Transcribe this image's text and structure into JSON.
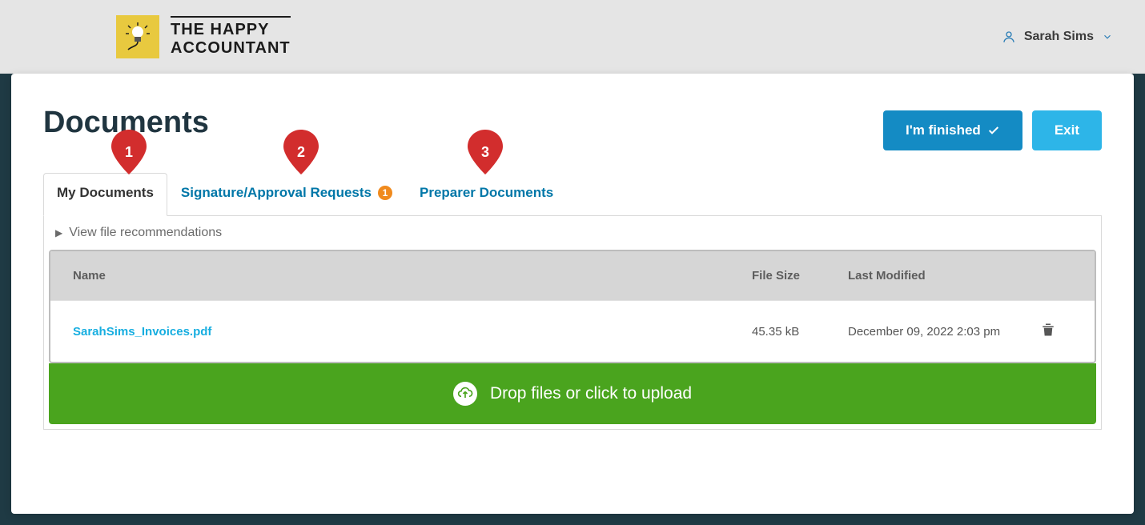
{
  "brand": {
    "line1": "THE HAPPY",
    "line2": "ACCOUNTANT"
  },
  "user": {
    "name": "Sarah Sims"
  },
  "page": {
    "title": "Documents"
  },
  "buttons": {
    "finished": "I'm finished",
    "exit": "Exit"
  },
  "tabs": {
    "my_docs": "My Documents",
    "sig_req": "Signature/Approval Requests",
    "sig_badge": "1",
    "preparer": "Preparer Documents"
  },
  "recommend": "View file recommendations",
  "columns": {
    "name": "Name",
    "size": "File Size",
    "modified": "Last Modified"
  },
  "files": [
    {
      "name": "SarahSims_Invoices.pdf",
      "size": "45.35 kB",
      "modified": "December 09, 2022 2:03 pm"
    }
  ],
  "dropzone": "Drop files or click to upload",
  "pins": {
    "p1": "1",
    "p2": "2",
    "p3": "3"
  }
}
